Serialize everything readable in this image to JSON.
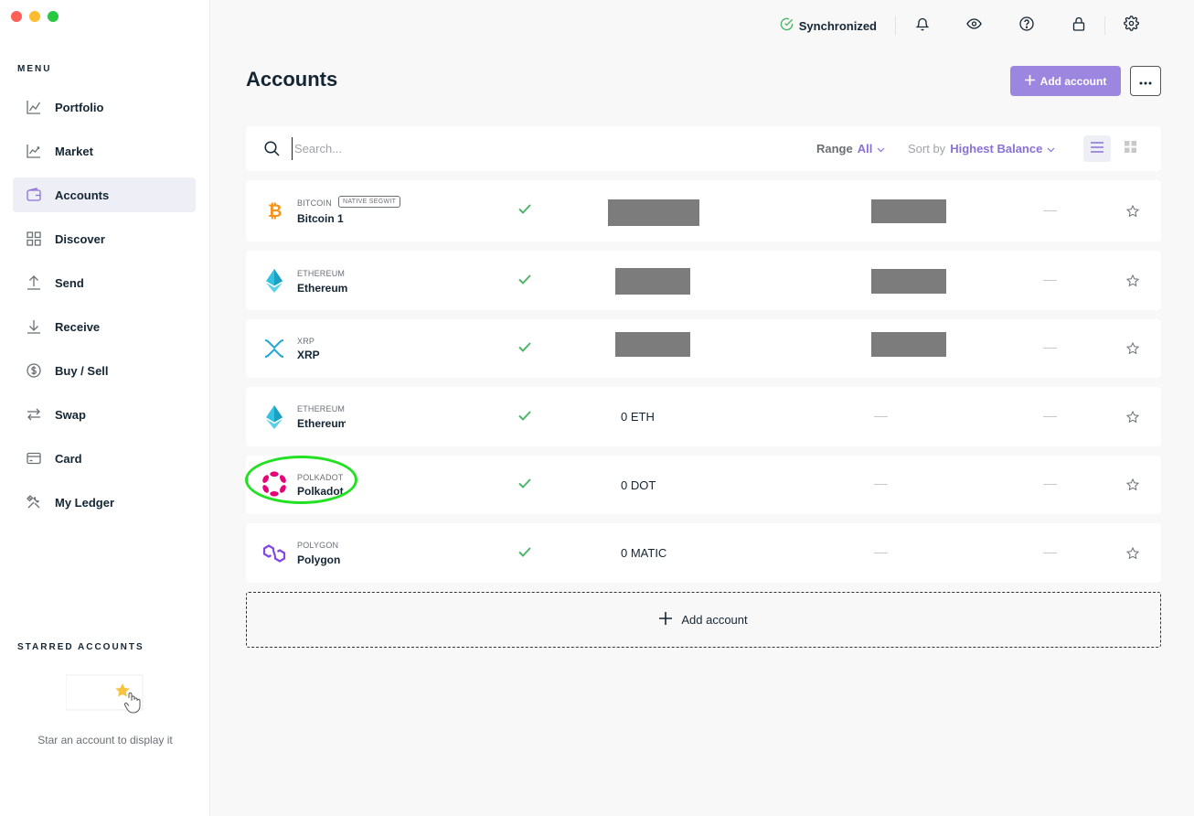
{
  "sidebar": {
    "menu_title": "MENU",
    "items": [
      {
        "label": "Portfolio",
        "icon": "chart-line-icon"
      },
      {
        "label": "Market",
        "icon": "market-chart-icon"
      },
      {
        "label": "Accounts",
        "icon": "wallet-icon",
        "active": true
      },
      {
        "label": "Discover",
        "icon": "grid-icon"
      },
      {
        "label": "Send",
        "icon": "arrow-up-icon"
      },
      {
        "label": "Receive",
        "icon": "arrow-down-icon"
      },
      {
        "label": "Buy / Sell",
        "icon": "dollar-icon"
      },
      {
        "label": "Swap",
        "icon": "swap-icon"
      },
      {
        "label": "Card",
        "icon": "card-icon"
      },
      {
        "label": "My Ledger",
        "icon": "tools-icon"
      }
    ],
    "starred_title": "STARRED ACCOUNTS",
    "starred_empty": "Star an account to display it"
  },
  "topbar": {
    "sync_label": "Synchronized"
  },
  "header": {
    "title": "Accounts",
    "add_button": "Add account"
  },
  "search": {
    "placeholder": "Search...",
    "range_label": "Range",
    "range_value": "All",
    "sort_label": "Sort by",
    "sort_value": "Highest Balance"
  },
  "accounts": [
    {
      "ticker": "BITCOIN",
      "name": "Bitcoin 1",
      "tag": "NATIVE SEGWIT",
      "balance": "",
      "redacted": true
    },
    {
      "ticker": "ETHEREUM",
      "name": "Ethereum",
      "balance": "",
      "redacted": true
    },
    {
      "ticker": "XRP",
      "name": "XRP",
      "balance": "",
      "redacted": true
    },
    {
      "ticker": "ETHEREUM",
      "name": "Ethereum",
      "balance": "0 ETH",
      "redacted": false
    },
    {
      "ticker": "POLKADOT",
      "name": "Polkadot",
      "balance": "0 DOT",
      "redacted": false
    },
    {
      "ticker": "POLYGON",
      "name": "Polygon",
      "balance": "0 MATIC",
      "redacted": false
    }
  ],
  "add_account_row": "Add account",
  "colors": {
    "accent": "#9d86e0",
    "sync_green": "#4cb56a",
    "highlight": "#22e022"
  }
}
